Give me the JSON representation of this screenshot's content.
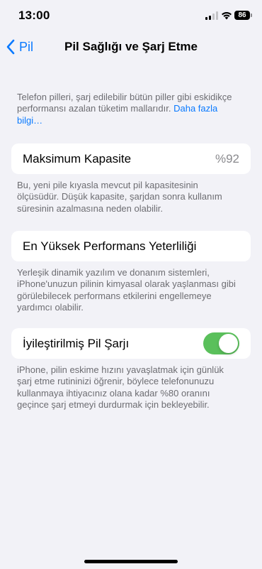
{
  "status_bar": {
    "time": "13:00",
    "battery_level": "86"
  },
  "nav": {
    "back_label": "Pil",
    "title": "Pil Sağlığı ve Şarj Etme"
  },
  "intro": {
    "text": "Telefon pilleri, şarj edilebilir bütün piller gibi eskidikçe performansı azalan tüketim mallarıdır. ",
    "link": "Daha fazla bilgi…"
  },
  "max_capacity": {
    "label": "Maksimum Kapasite",
    "value": "%92",
    "footnote": "Bu, yeni pile kıyasla mevcut pil kapasitesinin ölçüsüdür. Düşük kapasite, şarjdan sonra kullanım süresinin azalmasına neden olabilir."
  },
  "peak_performance": {
    "label": "En Yüksek Performans Yeterliliği",
    "footnote": "Yerleşik dinamik yazılım ve donanım sistemleri, iPhone'unuzun pilinin kimyasal olarak yaşlanması gibi görülebilecek performans etkilerini engellemeye yardımcı olabilir."
  },
  "optimized_charging": {
    "label": "İyileştirilmiş Pil Şarjı",
    "enabled": true,
    "footnote": "iPhone, pilin eskime hızını yavaşlatmak için günlük şarj etme rutininizi öğrenir, böylece telefonunuzu kullanmaya ihtiyacınız olana kadar %80 oranını geçince şarj etmeyi durdurmak için bekleyebilir."
  },
  "colors": {
    "accent": "#0a7aff",
    "toggle_on": "#5ac05b",
    "background": "#f2f2f7",
    "secondary_text": "#6d6d72"
  }
}
